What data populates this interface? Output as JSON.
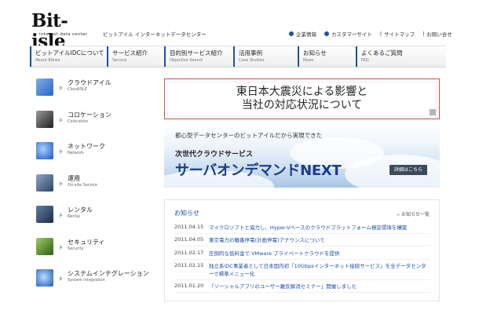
{
  "header": {
    "logo_text": "Bit-isle",
    "logo_sub": "internet data center",
    "tagline": "ビットアイル インターネットデータセンター",
    "links": [
      {
        "label": "企業情報"
      },
      {
        "label": "カスタマーサイト"
      },
      {
        "label": "サイトマップ"
      },
      {
        "label": "お問い合せ"
      }
    ]
  },
  "nav": {
    "items": [
      {
        "label": "ビットアイルIDCについて",
        "sub": "About Bitisle"
      },
      {
        "label": "サービス紹介",
        "sub": "Service"
      },
      {
        "label": "目的別サービス紹介",
        "sub": "Objective Search"
      },
      {
        "label": "活用事例",
        "sub": "Case Studies"
      },
      {
        "label": "お知らせ",
        "sub": "News"
      },
      {
        "label": "よくあるご質問",
        "sub": "FAQ"
      }
    ]
  },
  "sidebar": {
    "items": [
      {
        "label": "クラウドアイル",
        "sub": "CloudISLE",
        "icon": "cloud-icon"
      },
      {
        "label": "コロケーション",
        "sub": "Colocation",
        "icon": "server-rack-icon"
      },
      {
        "label": "ネットワーク",
        "sub": "Network",
        "icon": "network-icon"
      },
      {
        "label": "運用",
        "sub": "On-site Service",
        "icon": "operation-icon"
      },
      {
        "label": "レンタル",
        "sub": "Rental",
        "icon": "rental-server-icon"
      },
      {
        "label": "セキュリティ",
        "sub": "Security",
        "icon": "security-icon"
      },
      {
        "label": "システムインテグレーション",
        "sub": "System Integration",
        "icon": "system-integration-icon"
      }
    ]
  },
  "notice_banner": {
    "line1": "東日本大震災による影響と",
    "line2": "当社の対応状況について"
  },
  "promo_banner": {
    "line1": "都心型データセンターのビットアイルだから実現できた",
    "line2": "次世代クラウドサービス",
    "line3": "サーバオンデマンドNEXT",
    "button": "詳細はこちら"
  },
  "news": {
    "title": "お知らせ",
    "list_link": "お知らせ一覧",
    "items": [
      {
        "date": "2011.04.15",
        "text": "マイクロソフトと協力し、Hyper-Vベースのクラウドプラットフォーム検証環境を構築"
      },
      {
        "date": "2011.04.05",
        "text": "東京電力の輪番停電(計画停電)アナウンスについて"
      },
      {
        "date": "2011.02.17",
        "text": "圧倒的な低料金で VMware プライベートクラウドを提供"
      },
      {
        "date": "2011.02.15",
        "text": "独立系iDC事業者として日本国内初「10Gbpsインターネット接続サービス」を全データセンターで標準メニュー化"
      },
      {
        "date": "2011.01.20",
        "text": "「ソーシャルアプリのユーザー離反解消セミナー」開催しました"
      }
    ]
  },
  "colors": {
    "brand_blue": "#1d4fa5",
    "notice_border": "#c9524e",
    "promo_title": "#1b3f86"
  }
}
